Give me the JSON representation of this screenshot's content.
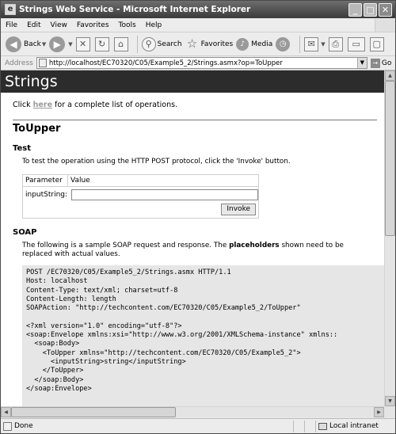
{
  "window": {
    "title": "Strings Web Service - Microsoft Internet Explorer"
  },
  "menu": [
    "File",
    "Edit",
    "View",
    "Favorites",
    "Tools",
    "Help"
  ],
  "toolbar": {
    "back": "Back",
    "search": "Search",
    "favorites": "Favorites",
    "media": "Media"
  },
  "address": {
    "label": "Address",
    "url": "http://localhost/EC70320/C05/Example5_2/Strings.asmx?op=ToUpper",
    "go": "Go"
  },
  "page": {
    "heading": "Strings",
    "lead_before": "Click ",
    "lead_link": "here",
    "lead_after": " for a complete list of operations.",
    "operation": "ToUpper",
    "test": {
      "heading": "Test",
      "desc": "To test the operation using the HTTP POST protocol, click the 'Invoke' button.",
      "col_param": "Parameter",
      "col_value": "Value",
      "param_name": "inputString:",
      "param_value": "",
      "invoke": "Invoke"
    },
    "soap": {
      "heading": "SOAP",
      "desc_before": "The following is a sample SOAP request and response. The ",
      "desc_bold": "placeholders",
      "desc_after": " shown need to be replaced with actual values.",
      "code": "POST /EC70320/C05/Example5_2/Strings.asmx HTTP/1.1\nHost: localhost\nContent-Type: text/xml; charset=utf-8\nContent-Length: length\nSOAPAction: \"http://techcontent.com/EC70320/C05/Example5_2/ToUpper\"\n\n<?xml version=\"1.0\" encoding=\"utf-8\"?>\n<soap:Envelope xmlns:xsi=\"http://www.w3.org/2001/XMLSchema-instance\" xmlns::\n  <soap:Body>\n    <ToUpper xmlns=\"http://techcontent.com/EC70320/C05/Example5_2\">\n      <inputString>string</inputString>\n    </ToUpper>\n  </soap:Body>\n</soap:Envelope>"
    }
  },
  "status": {
    "text": "Done",
    "zone": "Local intranet"
  }
}
